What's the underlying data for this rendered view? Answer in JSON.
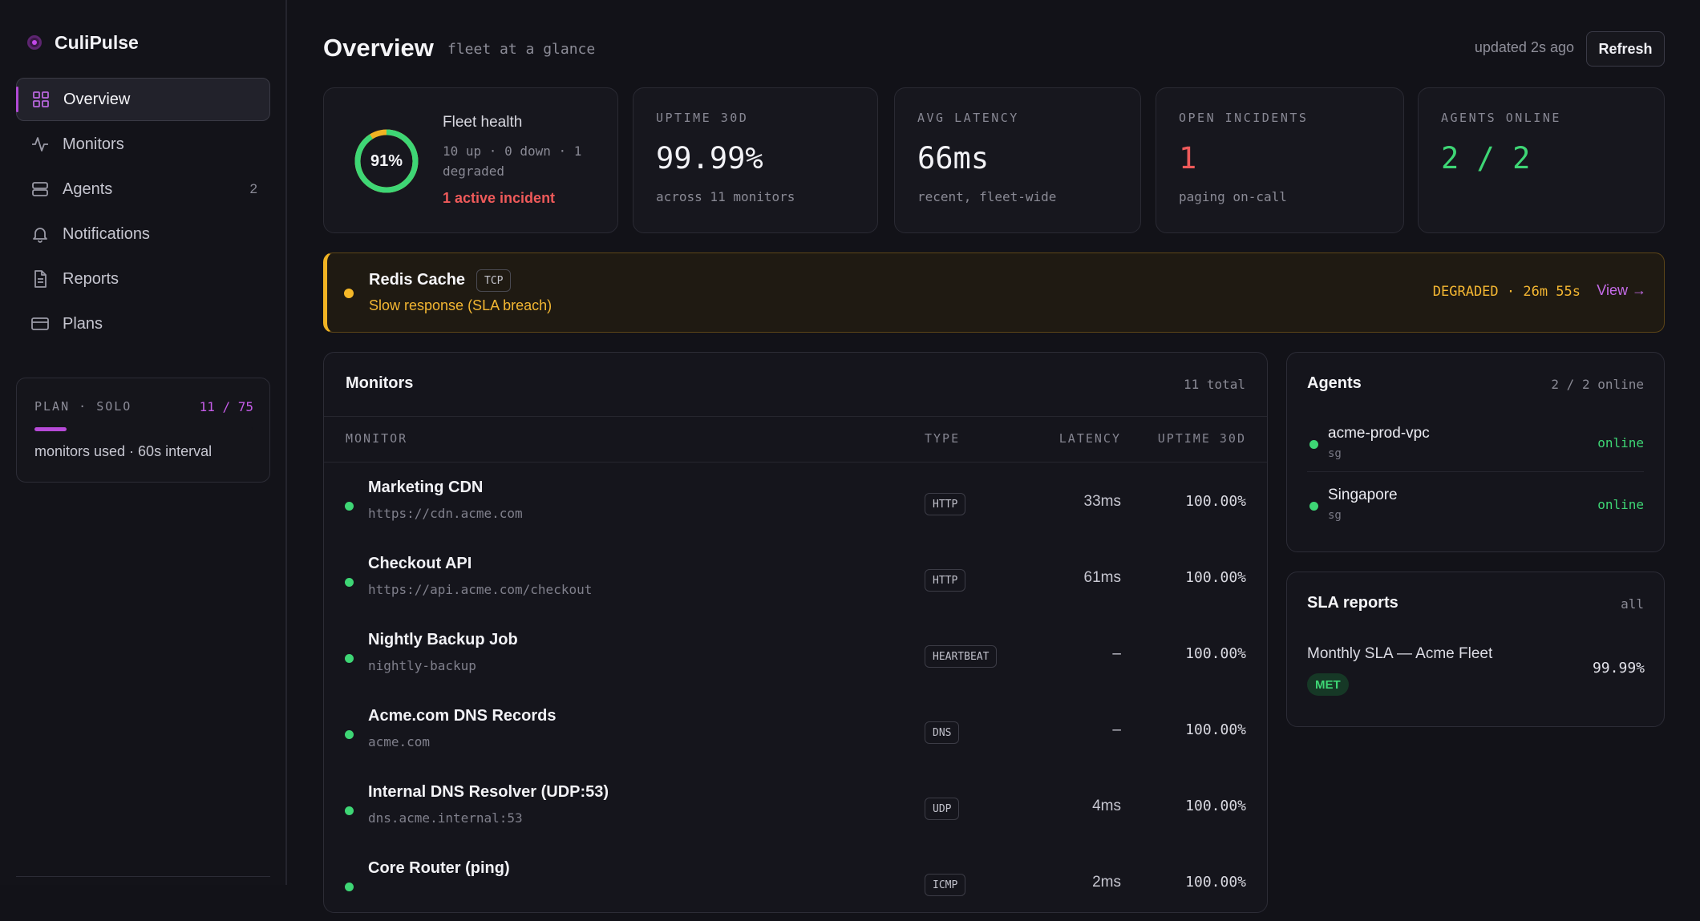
{
  "app": {
    "name": "CuliPulse"
  },
  "sidebar": {
    "items": [
      {
        "label": "Overview",
        "icon": "grid-icon",
        "active": true
      },
      {
        "label": "Monitors",
        "icon": "activity-icon"
      },
      {
        "label": "Agents",
        "icon": "server-icon",
        "count": "2"
      },
      {
        "label": "Notifications",
        "icon": "bell-icon"
      },
      {
        "label": "Reports",
        "icon": "file-icon"
      },
      {
        "label": "Plans",
        "icon": "card-icon"
      }
    ],
    "plan": {
      "label": "PLAN · SOLO",
      "usage": "11 / 75",
      "usage_fraction": 0.147,
      "caption": "monitors used · 60s interval"
    }
  },
  "header": {
    "title": "Overview",
    "subtitle": "fleet at a glance",
    "updated": "updated 2s ago",
    "refresh_label": "Refresh"
  },
  "stats": {
    "health": {
      "percent": "91%",
      "percent_value": 0.91,
      "title": "Fleet health",
      "detail": "10 up · 0 down · 1 degraded",
      "incident": "1 active incident"
    },
    "uptime": {
      "label": "UPTIME 30D",
      "value": "99.99%",
      "sub": "across 11 monitors"
    },
    "latency": {
      "label": "AVG LATENCY",
      "value": "66ms",
      "sub": "recent, fleet-wide"
    },
    "incidents": {
      "label": "OPEN INCIDENTS",
      "value": "1",
      "sub": "paging on-call"
    },
    "agents": {
      "label": "AGENTS ONLINE",
      "value": "2 / 2"
    }
  },
  "alert": {
    "name": "Redis Cache",
    "type": "TCP",
    "message": "Slow response (SLA breach)",
    "status": "DEGRADED · 26m 55s",
    "view_label": "View →"
  },
  "monitors": {
    "title": "Monitors",
    "total": "11 total",
    "columns": {
      "monitor": "MONITOR",
      "type": "TYPE",
      "latency": "LATENCY",
      "uptime": "UPTIME 30D"
    },
    "rows": [
      {
        "name": "Marketing CDN",
        "target": "https://cdn.acme.com",
        "type": "HTTP",
        "latency": "33ms",
        "uptime": "100.00%"
      },
      {
        "name": "Checkout API",
        "target": "https://api.acme.com/checkout",
        "type": "HTTP",
        "latency": "61ms",
        "uptime": "100.00%"
      },
      {
        "name": "Nightly Backup Job",
        "target": "nightly-backup",
        "type": "HEARTBEAT",
        "latency": "–",
        "uptime": "100.00%"
      },
      {
        "name": "Acme.com DNS Records",
        "target": "acme.com",
        "type": "DNS",
        "latency": "–",
        "uptime": "100.00%"
      },
      {
        "name": "Internal DNS Resolver (UDP:53)",
        "target": "dns.acme.internal:53",
        "type": "UDP",
        "latency": "4ms",
        "uptime": "100.00%"
      },
      {
        "name": "Core Router (ping)",
        "target": "",
        "type": "ICMP",
        "latency": "2ms",
        "uptime": "100.00%"
      }
    ]
  },
  "agents": {
    "title": "Agents",
    "summary": "2 / 2 online",
    "rows": [
      {
        "name": "acme-prod-vpc",
        "region": "sg",
        "status": "online"
      },
      {
        "name": "Singapore",
        "region": "sg",
        "status": "online"
      }
    ]
  },
  "sla": {
    "title": "SLA reports",
    "filter": "all",
    "report": {
      "name": "Monthly SLA — Acme Fleet",
      "badge": "MET",
      "value": "99.99%"
    }
  },
  "colors": {
    "accent": "#b74ad8",
    "up": "#3ed675",
    "degraded": "#f0b323",
    "incident": "#ef5a5a"
  }
}
